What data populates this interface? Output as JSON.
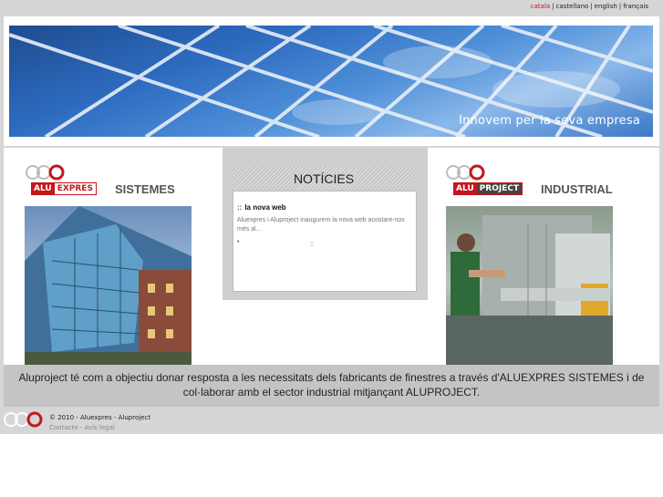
{
  "languages": [
    {
      "label": "catala",
      "active": true
    },
    {
      "label": "castellano",
      "active": false
    },
    {
      "label": "english",
      "active": false
    },
    {
      "label": "français",
      "active": false
    }
  ],
  "banner": {
    "tagline": "Innovem per la seva empresa"
  },
  "left": {
    "brand_alu": "ALU",
    "brand_name": "EXPRES",
    "section": "SISTEMES"
  },
  "right": {
    "brand_alu": "ALU",
    "brand_name": "PROJECT",
    "section": "INDUSTRIAL"
  },
  "news": {
    "heading": "NOTÍCIES",
    "item_marker": "::",
    "item_title": "la nova web",
    "item_text": "Aluexpres i Aluproject inaugurem la nova web acostant-nos més al...",
    "bullet": "•",
    "more": "::"
  },
  "description": "Aluproject té com a objectiu donar resposta a les necessitats dels fabricants de finestres a través d'ALUEXPRES SISTEMES i de col·laborar amb el sector industrial mitjançant ALUPROJECT.",
  "footer": {
    "copyright": "© 2010 - Aluexpres - Aluproject",
    "contact": "Contacte",
    "sep": "-",
    "legal": "Avis legal"
  },
  "colors": {
    "brand_red": "#c4161c",
    "banner_blue": "#2d6bbf"
  }
}
